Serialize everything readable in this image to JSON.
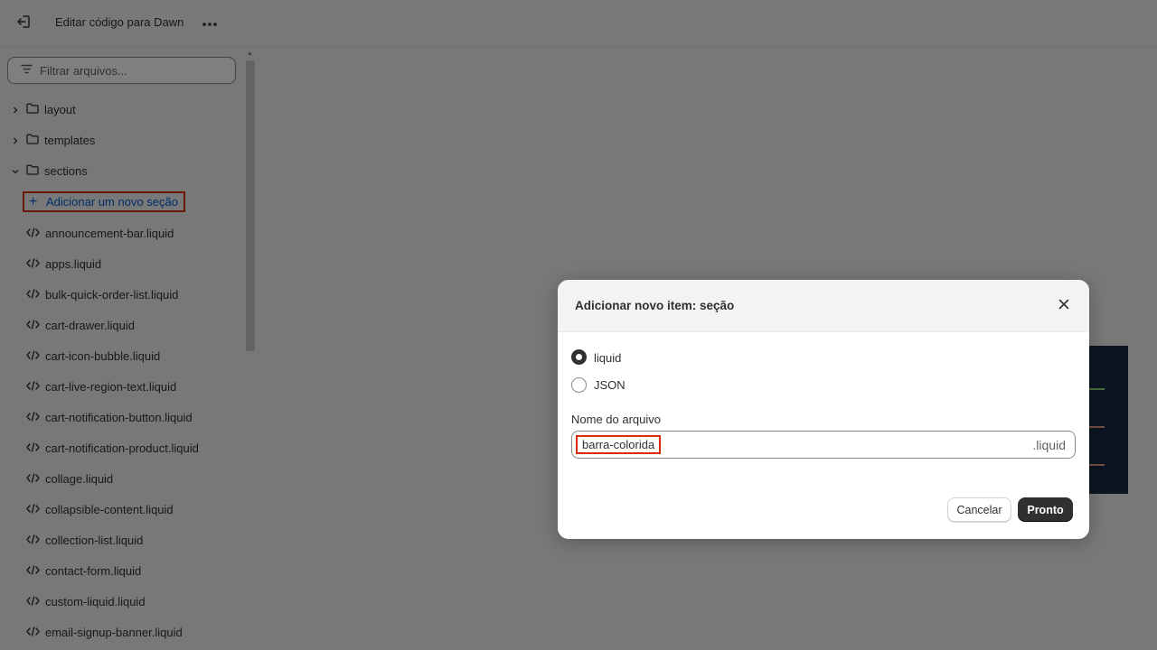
{
  "topbar": {
    "title": "Editar código para Dawn",
    "exit_icon": "exit-icon",
    "more_icon": "more-horizontal-icon"
  },
  "sidebar": {
    "filter_placeholder": "Filtrar arquivos...",
    "folders": [
      {
        "label": "layout",
        "expanded": false
      },
      {
        "label": "templates",
        "expanded": false
      },
      {
        "label": "sections",
        "expanded": true
      }
    ],
    "add_section_label": "Adicionar um novo seção",
    "files": [
      "announcement-bar.liquid",
      "apps.liquid",
      "bulk-quick-order-list.liquid",
      "cart-drawer.liquid",
      "cart-icon-bubble.liquid",
      "cart-live-region-text.liquid",
      "cart-notification-button.liquid",
      "cart-notification-product.liquid",
      "collage.liquid",
      "collapsible-content.liquid",
      "collection-list.liquid",
      "contact-form.liquid",
      "custom-liquid.liquid",
      "email-signup-banner.liquid"
    ]
  },
  "modal": {
    "title": "Adicionar novo item: seção",
    "options": [
      {
        "label": "liquid",
        "selected": true
      },
      {
        "label": "JSON",
        "selected": false
      }
    ],
    "field_label": "Nome do arquivo",
    "field_value": "barra-colorida",
    "field_suffix": ".liquid",
    "cancel_label": "Cancelar",
    "done_label": "Pronto"
  },
  "colors": {
    "accent_link": "#005bd3",
    "highlight_border": "#d82c0d",
    "primary_button": "#303030"
  }
}
